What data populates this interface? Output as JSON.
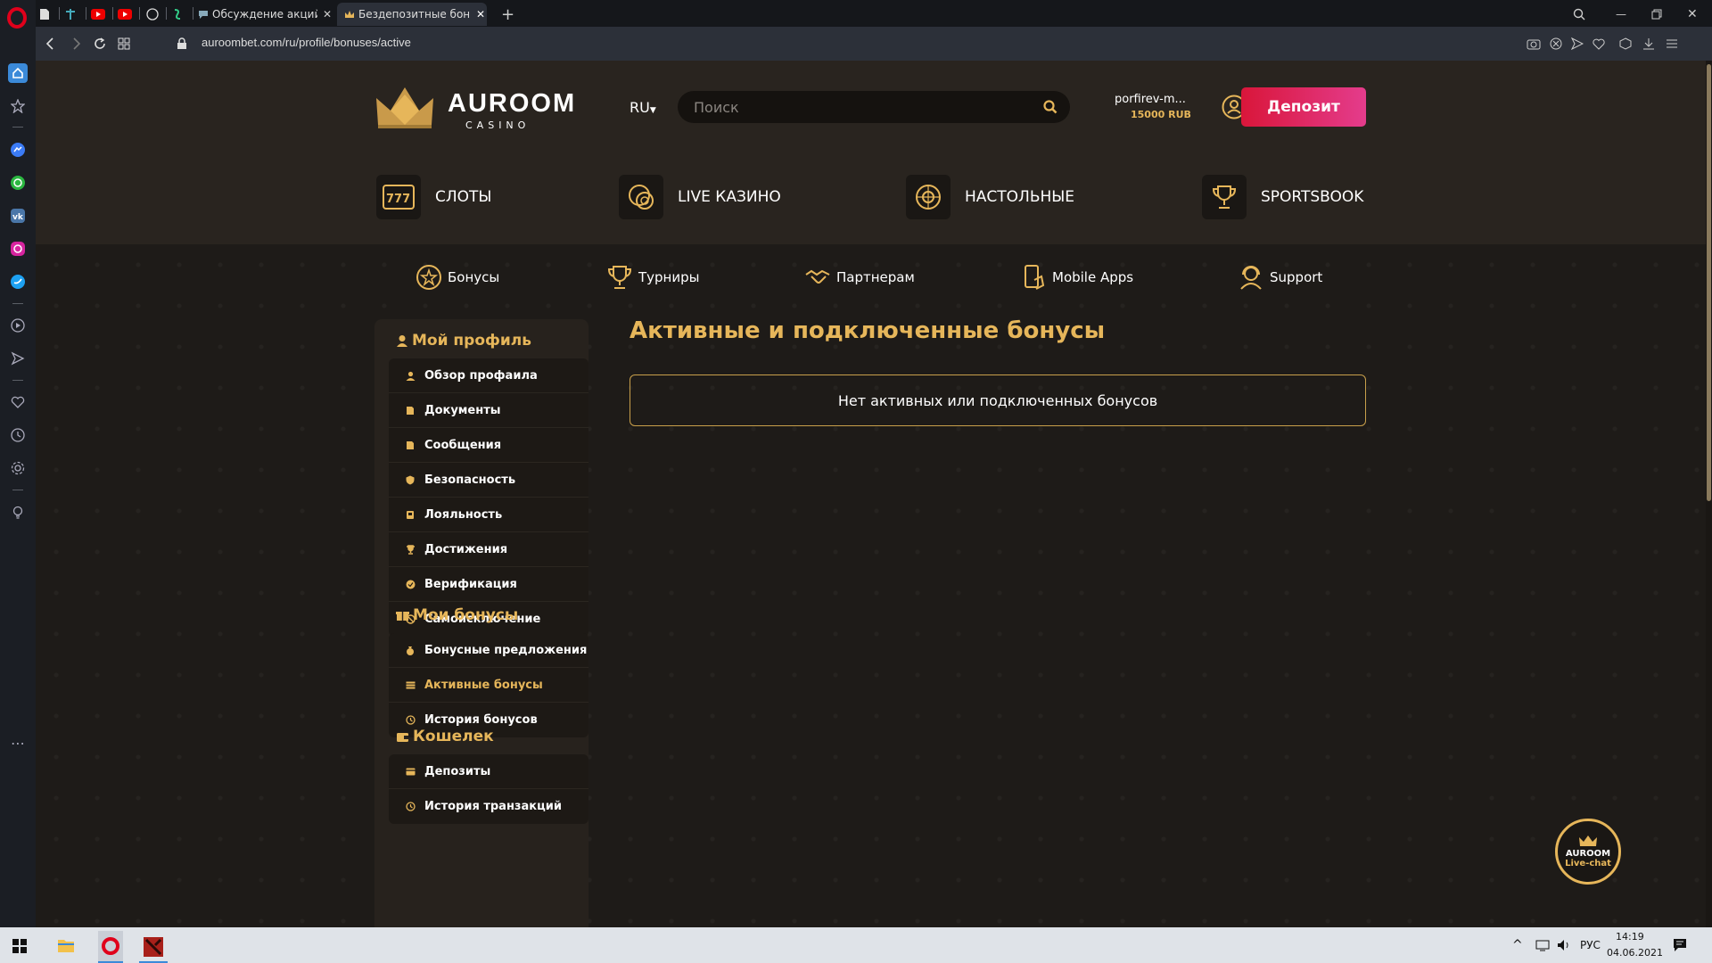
{
  "browser": {
    "tabs": [
      {
        "label": "Обсуждение акций и кон"
      },
      {
        "label": "Бездепозитные бонусы в"
      }
    ],
    "url": "auroombet.com/ru/profile/bonuses/active"
  },
  "site": {
    "logo": {
      "title": "AUROOM",
      "subtitle": "CASINO"
    },
    "lang": "RU",
    "search_placeholder": "Поиск",
    "user": {
      "name": "porfirev-m...",
      "balance": "15000 RUB"
    },
    "deposit_label": "Депозит",
    "main_nav": [
      {
        "label": "СЛОТЫ",
        "icon": "slots-icon"
      },
      {
        "label": "LIVE КАЗИНО",
        "icon": "chips-icon"
      },
      {
        "label": "НАСТОЛЬНЫЕ",
        "icon": "roulette-icon"
      },
      {
        "label": "SPORTSBOOK",
        "icon": "trophy-icon"
      }
    ],
    "sub_nav": [
      {
        "label": "Бонусы",
        "icon": "bonus-icon"
      },
      {
        "label": "Турниры",
        "icon": "cup-icon"
      },
      {
        "label": "Партнерам",
        "icon": "handshake-icon"
      },
      {
        "label": "Mobile Apps",
        "icon": "mobile-icon"
      },
      {
        "label": "Support",
        "icon": "support-icon"
      }
    ],
    "profile": {
      "heading": "Мой профиль",
      "items": [
        {
          "label": "Обзор профаила"
        },
        {
          "label": "Документы"
        },
        {
          "label": "Сообщения"
        },
        {
          "label": "Безопасность"
        },
        {
          "label": "Лояльность"
        },
        {
          "label": "Достижения"
        },
        {
          "label": "Верификация"
        },
        {
          "label": "Самоисключение"
        }
      ]
    },
    "bonuses": {
      "heading": "Мои бонусы",
      "items": [
        {
          "label": "Бонусные предложения"
        },
        {
          "label": "Активные бонусы",
          "active": true
        },
        {
          "label": "История бонусов"
        }
      ]
    },
    "wallet": {
      "heading": "Кошелек",
      "items": [
        {
          "label": "Депозиты"
        },
        {
          "label": "История транзакций"
        }
      ]
    },
    "page_title": "Активные и подключенные бонусы",
    "empty_message": "Нет активных или подключенных бонусов",
    "livechat": {
      "line1": "AUROOM",
      "line2": "Live-chat"
    },
    "accent_color": "#e6b65a"
  },
  "taskbar": {
    "lang": "РУС",
    "time": "14:19",
    "date": "04.06.2021"
  }
}
